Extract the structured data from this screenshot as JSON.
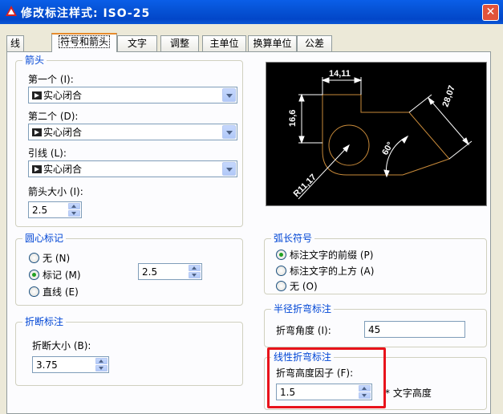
{
  "window": {
    "title": "修改标注样式: ISO-25",
    "close_glyph": "✕"
  },
  "tabs": [
    {
      "label": "线",
      "active": false
    },
    {
      "label": "符号和箭头",
      "active": true
    },
    {
      "label": "文字",
      "active": false
    },
    {
      "label": "调整",
      "active": false
    },
    {
      "label": "主单位",
      "active": false
    },
    {
      "label": "换算单位",
      "active": false
    },
    {
      "label": "公差",
      "active": false
    }
  ],
  "arrowheads": {
    "title": "箭头",
    "first_label": "第一个 (I):",
    "first_value": "实心闭合",
    "second_label": "第二个 (D):",
    "second_value": "实心闭合",
    "leader_label": "引线 (L):",
    "leader_value": "实心闭合",
    "size_label": "箭头大小 (I):",
    "size_value": "2.5"
  },
  "preview": {
    "dims": [
      "14,11",
      "16,6",
      "28,07",
      "60°",
      "R11,17"
    ],
    "line_color": "#c88a3a"
  },
  "center_marks": {
    "title": "圆心标记",
    "options": [
      {
        "label": "无 (N)",
        "selected": false
      },
      {
        "label": "标记 (M)",
        "selected": true
      },
      {
        "label": "直线 (E)",
        "selected": false
      }
    ],
    "size_value": "2.5"
  },
  "arc_length": {
    "title": "弧长符号",
    "options": [
      {
        "label": "标注文字的前缀 (P)",
        "selected": true
      },
      {
        "label": "标注文字的上方 (A)",
        "selected": false
      },
      {
        "label": "无 (O)",
        "selected": false
      }
    ]
  },
  "break": {
    "title": "折断标注",
    "size_label": "折断大小 (B):",
    "size_value": "3.75"
  },
  "radius_jog": {
    "title": "半径折弯标注",
    "angle_label": "折弯角度 (I):",
    "angle_value": "45"
  },
  "linear_jog": {
    "title": "线性折弯标注",
    "factor_label": "折弯高度因子 (F):",
    "factor_value": "1.5",
    "suffix": "* 文字高度"
  },
  "colors": {
    "highlight": "#e8131b",
    "group_title": "#0046d5"
  }
}
